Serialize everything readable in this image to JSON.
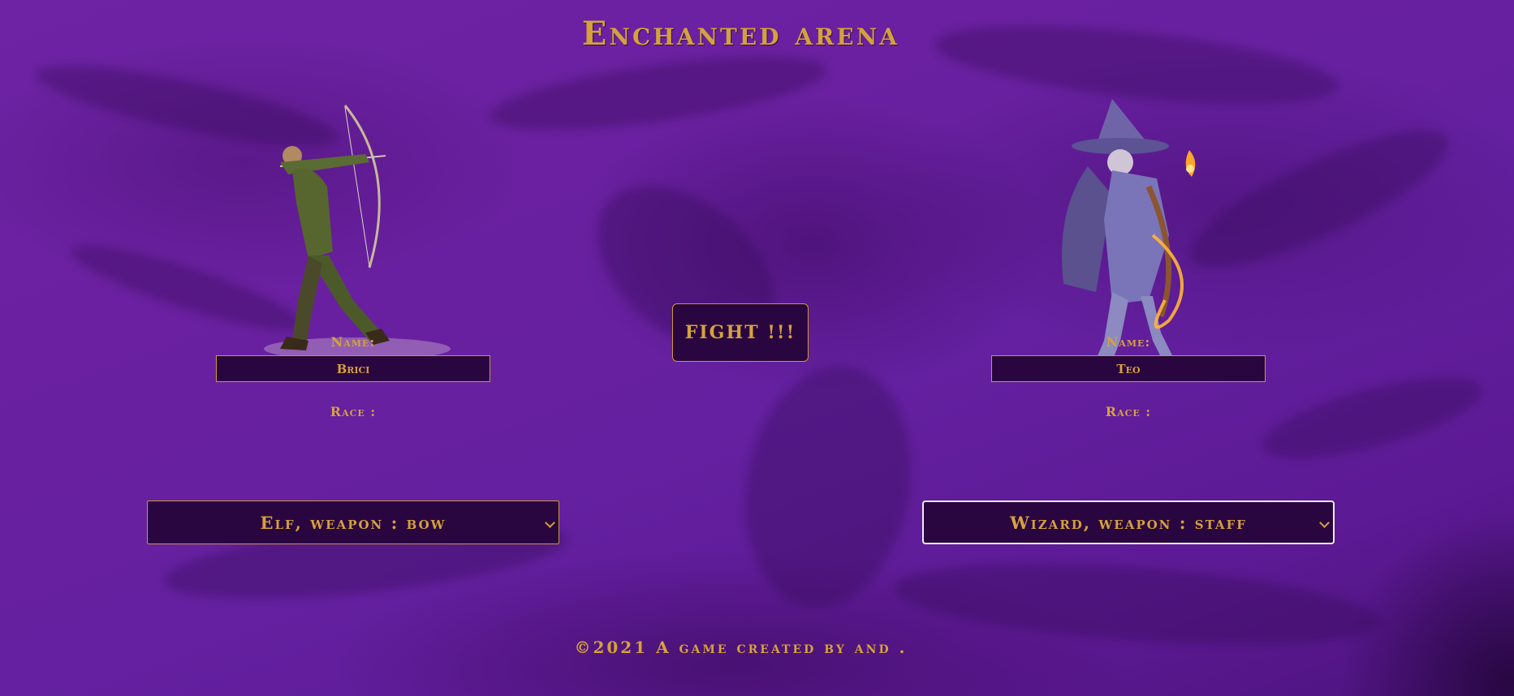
{
  "page": {
    "title": "Enchanted arena",
    "footer": "©2021 A game created by and ."
  },
  "fight_button": {
    "label": "FIGHT !!!"
  },
  "players": [
    {
      "name_label": "Name:",
      "name_value": "Brici",
      "race_label": "Race :",
      "race_selected": "Elf, weapon : bow",
      "portrait": "elf-archer"
    },
    {
      "name_label": "Name:",
      "name_value": "Teo",
      "race_label": "Race :",
      "race_selected": "Wizard, weapon : staff",
      "portrait": "wizard"
    }
  ],
  "colors": {
    "background": "#6a20a0",
    "accent_gold": "#d4a23c",
    "control_bg": "#2a0640"
  }
}
